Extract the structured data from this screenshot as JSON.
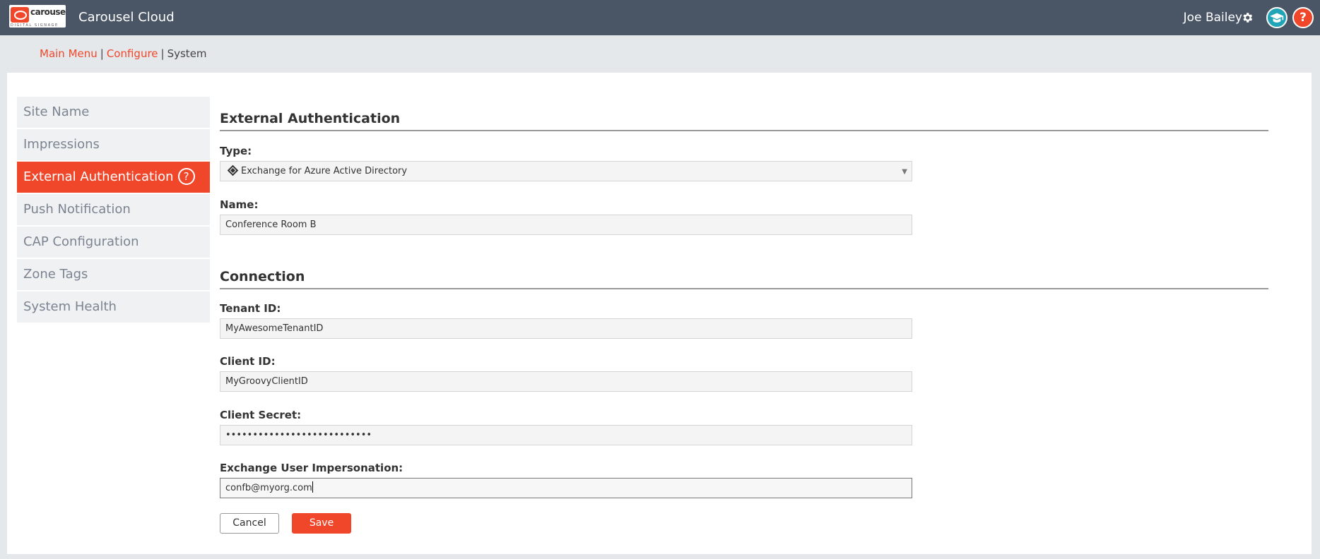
{
  "header": {
    "logo_text": "carousel",
    "logo_sub": "DIGITAL SIGNAGE",
    "app_title": "Carousel Cloud",
    "user_name": "Joe Bailey",
    "help_glyph": "?",
    "icons": [
      "gear-icon",
      "graduation-cap-icon",
      "help-icon"
    ]
  },
  "breadcrumb": {
    "items": [
      "Main Menu",
      "Configure",
      "System"
    ],
    "separator": "|"
  },
  "sidebar": {
    "items": [
      {
        "label": "Site Name"
      },
      {
        "label": "Impressions"
      },
      {
        "label": "External Authentication",
        "active": true
      },
      {
        "label": "Push Notification"
      },
      {
        "label": "CAP Configuration"
      },
      {
        "label": "Zone Tags"
      },
      {
        "label": "System Health"
      }
    ],
    "help_glyph": "?"
  },
  "form": {
    "section1_title": "External Authentication",
    "type_label": "Type:",
    "type_value": "Exchange for Azure Active Directory",
    "name_label": "Name:",
    "name_value": "Conference Room B",
    "section2_title": "Connection",
    "tenant_label": "Tenant ID:",
    "tenant_value": "MyAwesomeTenantID",
    "client_label": "Client ID:",
    "client_value": "MyGroovyClientID",
    "secret_label": "Client Secret:",
    "secret_value": "•••••••••••••••••••••••••••",
    "impersonation_label": "Exchange User Impersonation:",
    "impersonation_value": "confb@myorg.com",
    "cancel_label": "Cancel",
    "save_label": "Save"
  },
  "colors": {
    "accent": "#f0472b",
    "topbar": "#4a5566",
    "teal": "#21a3b8"
  }
}
